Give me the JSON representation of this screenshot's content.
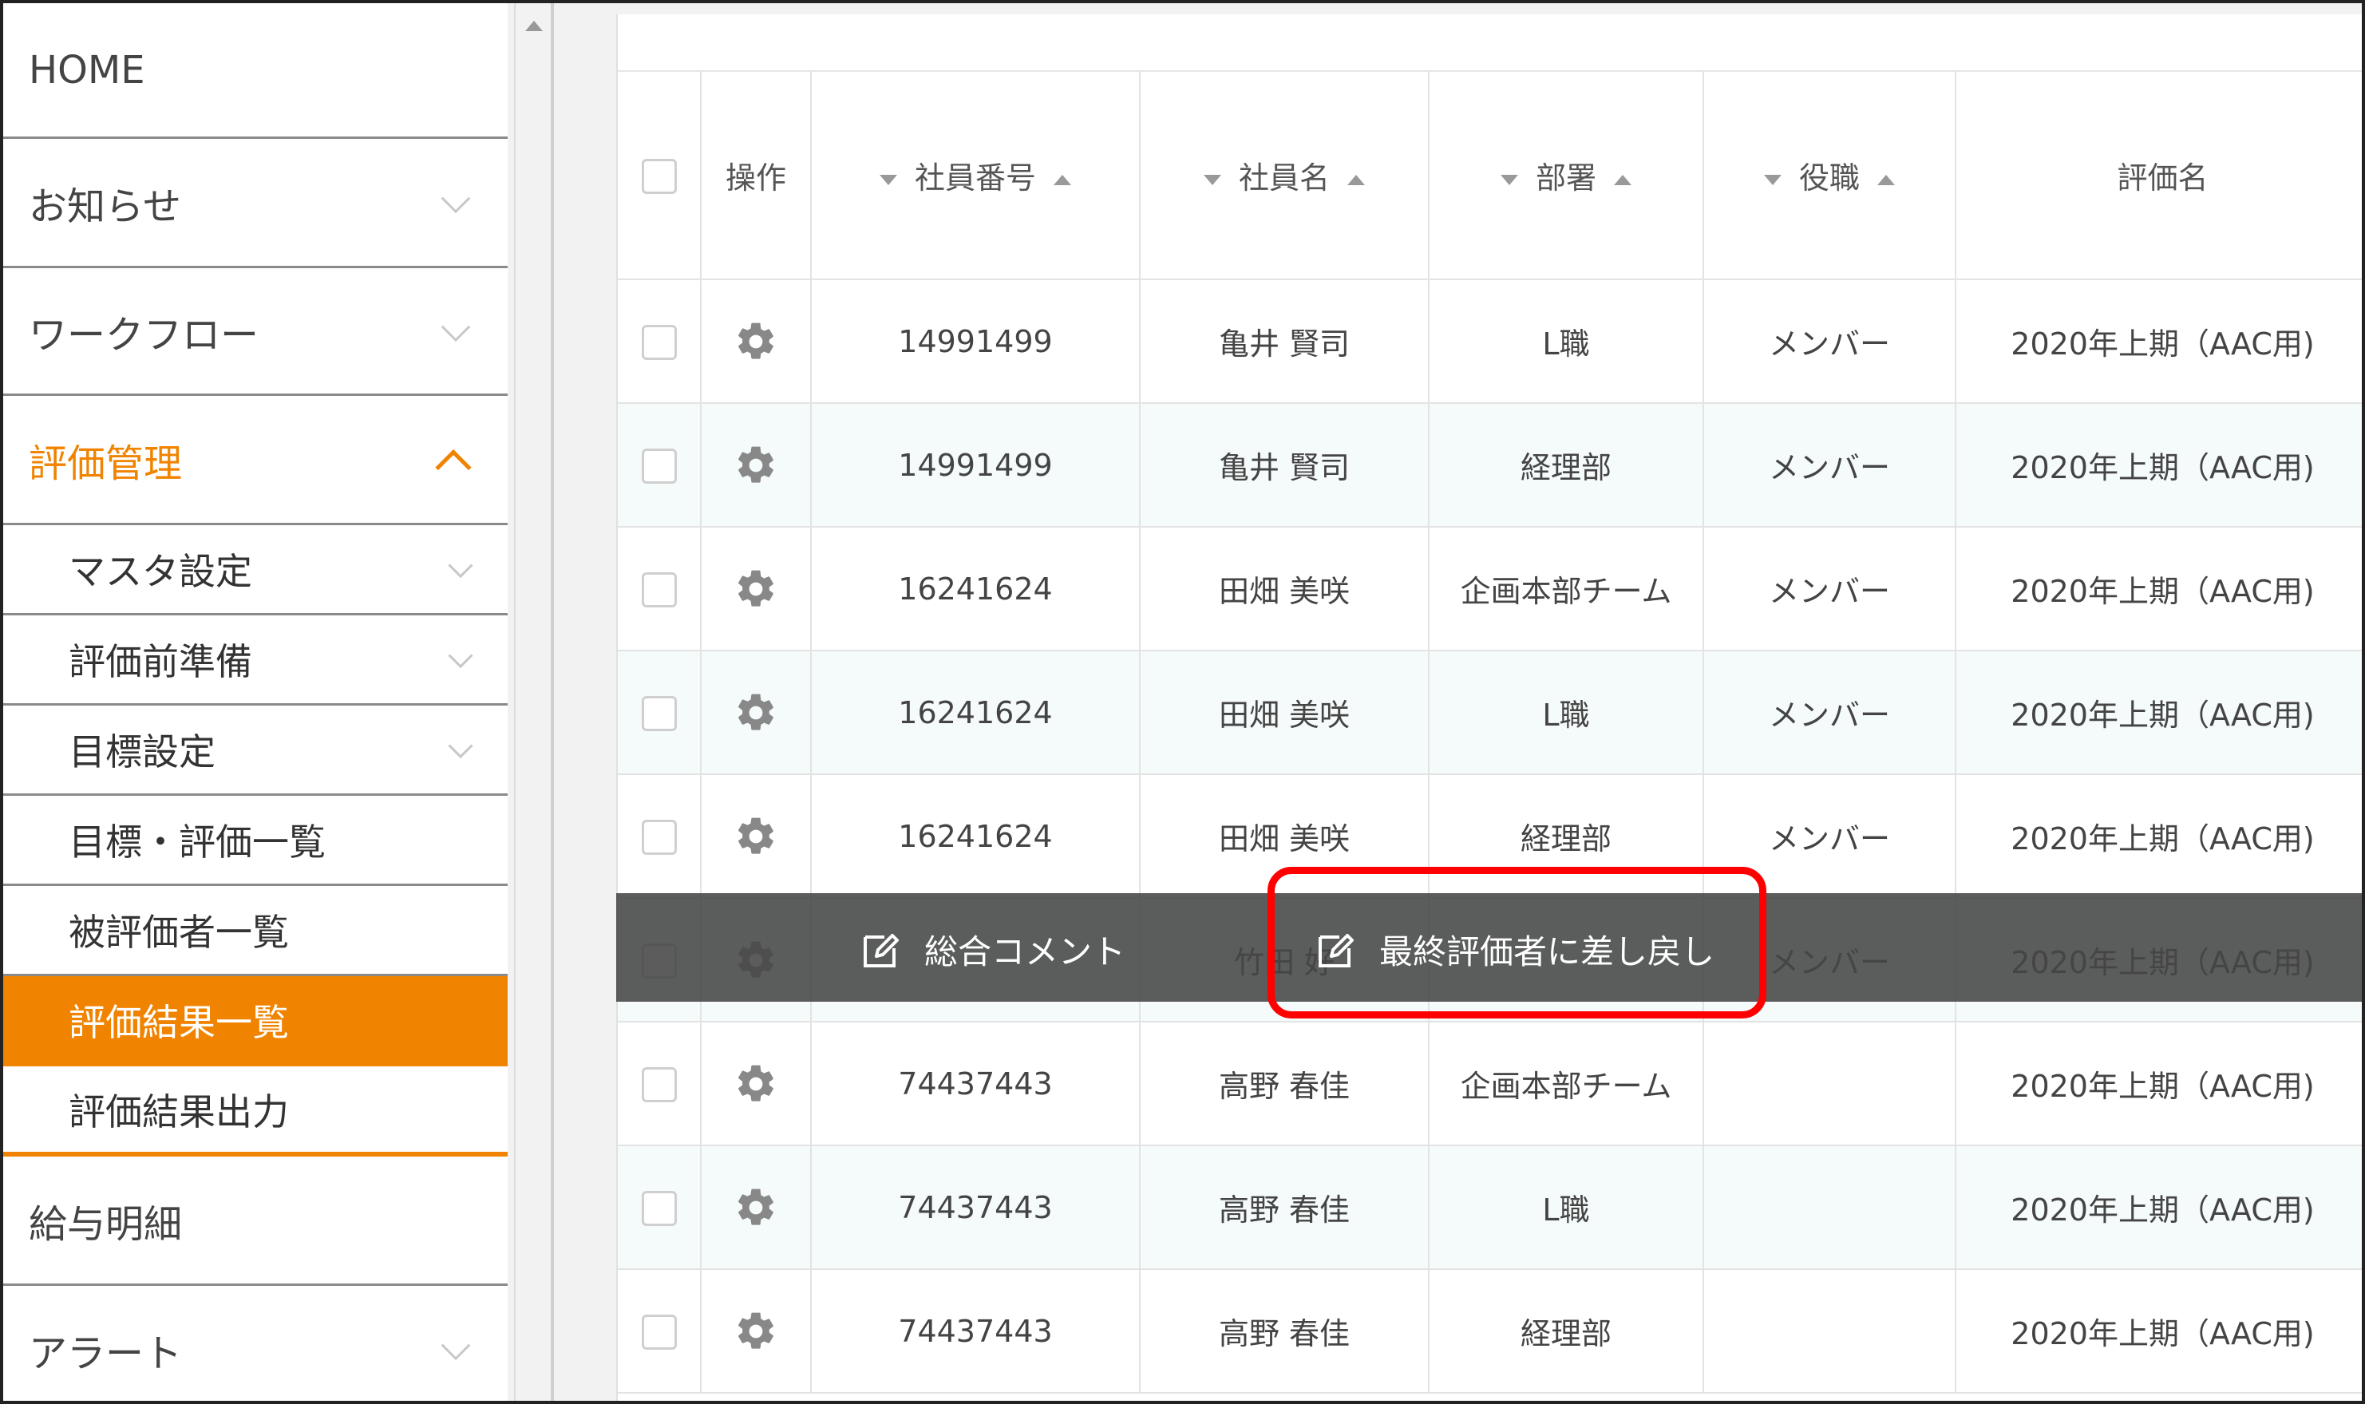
{
  "sidebar": {
    "items": [
      {
        "label": "HOME"
      },
      {
        "label": "お知らせ"
      },
      {
        "label": "ワークフロー"
      },
      {
        "label": "評価管理"
      },
      {
        "label": "給与明細"
      },
      {
        "label": "アラート"
      }
    ],
    "sub_items": [
      {
        "label": "マスタ設定"
      },
      {
        "label": "評価前準備"
      },
      {
        "label": "目標設定"
      },
      {
        "label": "目標・評価一覧"
      },
      {
        "label": "被評価者一覧"
      },
      {
        "label": "評価結果一覧"
      },
      {
        "label": "評価結果出力"
      }
    ],
    "active_color": "#f08300"
  },
  "table": {
    "headers": {
      "op": "操作",
      "emp_no": "社員番号",
      "emp_name": "社員名",
      "dept": "部署",
      "role": "役職",
      "eval": "評価名"
    },
    "rows": [
      {
        "emp_no": "14991499",
        "name": "亀井 賢司",
        "dept": "L職",
        "role": "メンバー",
        "eval": "2020年上期（AAC用)"
      },
      {
        "emp_no": "14991499",
        "name": "亀井 賢司",
        "dept": "経理部",
        "role": "メンバー",
        "eval": "2020年上期（AAC用)"
      },
      {
        "emp_no": "16241624",
        "name": "田畑 美咲",
        "dept": "企画本部チーム",
        "role": "メンバー",
        "eval": "2020年上期（AAC用)"
      },
      {
        "emp_no": "16241624",
        "name": "田畑 美咲",
        "dept": "L職",
        "role": "メンバー",
        "eval": "2020年上期（AAC用)"
      },
      {
        "emp_no": "16241624",
        "name": "田畑 美咲",
        "dept": "経理部",
        "role": "メンバー",
        "eval": "2020年上期（AAC用)"
      },
      {
        "emp_no": "",
        "name": "竹田 好",
        "dept": "",
        "role": "メンバー",
        "eval": "2020年上期（AAC用)"
      },
      {
        "emp_no": "74437443",
        "name": "高野 春佳",
        "dept": "企画本部チーム",
        "role": "",
        "eval": "2020年上期（AAC用)"
      },
      {
        "emp_no": "74437443",
        "name": "高野 春佳",
        "dept": "L職",
        "role": "",
        "eval": "2020年上期（AAC用)"
      },
      {
        "emp_no": "74437443",
        "name": "高野 春佳",
        "dept": "経理部",
        "role": "",
        "eval": "2020年上期（AAC用)"
      }
    ]
  },
  "action_bar": {
    "comment_label": "総合コメント",
    "return_label": "最終評価者に差し戻し"
  },
  "colors": {
    "highlight": "#ff0000",
    "accent": "#f08300"
  }
}
